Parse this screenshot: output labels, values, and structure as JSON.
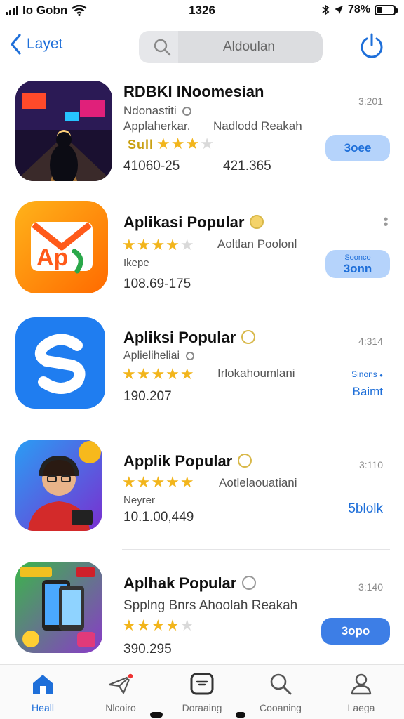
{
  "status_bar": {
    "carrier": "Io Gobn",
    "time": "1326",
    "battery": "78%"
  },
  "nav": {
    "back_label": "Layet",
    "search_value": "Aldoulan"
  },
  "apps": [
    {
      "title": "RDBKI INoomesian",
      "subtitle": "Ndonastiti",
      "category": "Applaherkar.",
      "secondary": "Nadlodd Reakah",
      "rating_text": "Sull",
      "stars": 3,
      "stats_left": "41060-25",
      "stats_right": "421.365",
      "meta": "3:201",
      "button": "3oee"
    },
    {
      "title": "Aplikasi Popular",
      "subtitle": "Aoltlan Poolonl",
      "category": "Ikepe",
      "stars": 4,
      "stats_left": "108.69-175",
      "button_top": "Soonco",
      "button": "3onn"
    },
    {
      "title": "Apliksi Popular",
      "subtitle": "Aplieliheliai",
      "secondary": "Irlokahoumlani",
      "stars": 5,
      "stats_left": "190.207",
      "meta": "4:314",
      "link_top": "Sinons",
      "link": "Baimt"
    },
    {
      "title": "Applik Popular",
      "subtitle": "Aotlelaouatiani",
      "category": "Neyrer",
      "stars": 5,
      "stats_left": "10.1.00,449",
      "meta": "3:110",
      "link": "5blolk"
    },
    {
      "title": "Aplhak Popular",
      "subtitle": "Spplng Bnrs Ahoolah Reakah",
      "stars": 4,
      "stats_left": "390.295",
      "meta": "3:140",
      "button": "3opo"
    }
  ],
  "tabbar": [
    {
      "label": "Heall",
      "icon": "home-icon",
      "active": true
    },
    {
      "label": "Nlcoiro",
      "icon": "paper-plane-icon",
      "active": false
    },
    {
      "label": "Doraaing",
      "icon": "download-box-icon",
      "active": false
    },
    {
      "label": "Cooaning",
      "icon": "search-icon",
      "active": false
    },
    {
      "label": "Laega",
      "icon": "person-icon",
      "active": false
    }
  ],
  "colors": {
    "accent": "#1e6fd9",
    "star": "#f2b51c",
    "button_light": "#b5d3fb",
    "button_solid": "#3d7ee6"
  }
}
